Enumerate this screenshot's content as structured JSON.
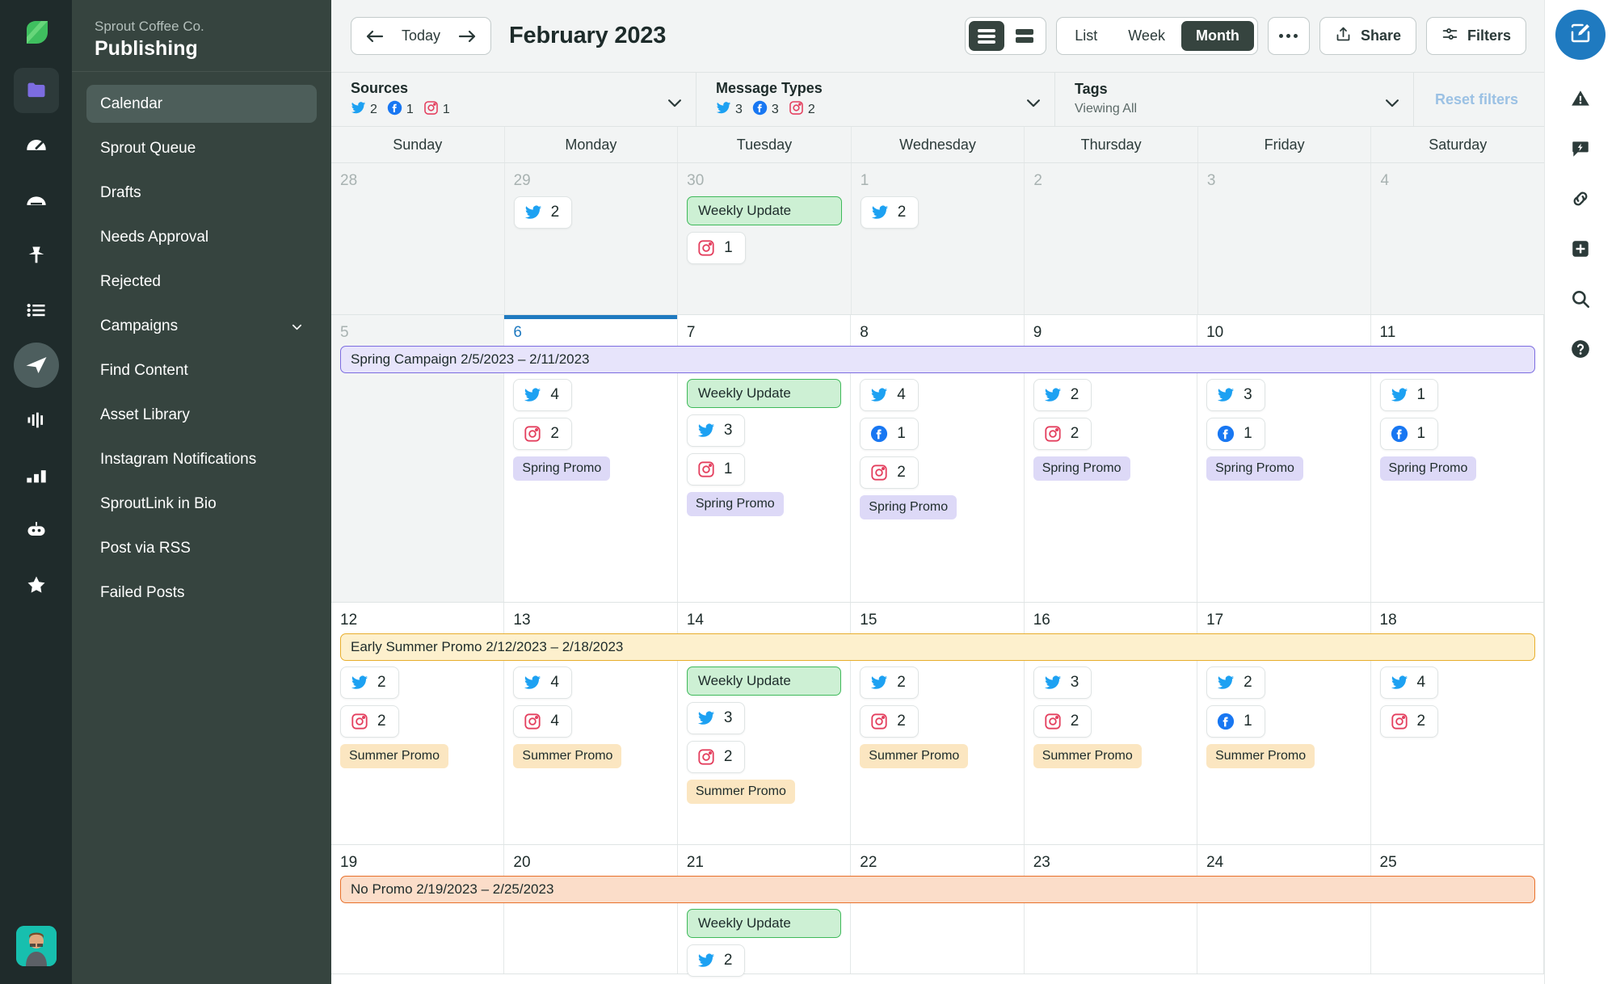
{
  "icon_rail": {
    "logo": "sprout-leaf-logo",
    "items": [
      {
        "icon": "folder-icon",
        "active": true
      },
      {
        "icon": "dashboard-gauge-icon",
        "active": false
      },
      {
        "icon": "inbox-icon",
        "active": false
      },
      {
        "icon": "pin-icon",
        "active": false
      },
      {
        "icon": "list-icon",
        "active": false
      },
      {
        "icon": "paper-plane-icon",
        "active": true
      },
      {
        "icon": "audio-waveform-icon",
        "active": false
      },
      {
        "icon": "bar-chart-icon",
        "active": false
      },
      {
        "icon": "bot-icon",
        "active": false
      },
      {
        "icon": "star-icon",
        "active": false
      }
    ],
    "avatar": "user-avatar"
  },
  "sidebar": {
    "org": "Sprout Coffee Co.",
    "title": "Publishing",
    "items": [
      {
        "label": "Calendar",
        "active": true,
        "chevron": false
      },
      {
        "label": "Sprout Queue",
        "active": false,
        "chevron": false
      },
      {
        "label": "Drafts",
        "active": false,
        "chevron": false
      },
      {
        "label": "Needs Approval",
        "active": false,
        "chevron": false
      },
      {
        "label": "Rejected",
        "active": false,
        "chevron": false
      },
      {
        "label": "Campaigns",
        "active": false,
        "chevron": true
      },
      {
        "label": "Find Content",
        "active": false,
        "chevron": false
      },
      {
        "label": "Asset Library",
        "active": false,
        "chevron": false
      },
      {
        "label": "Instagram Notifications",
        "active": false,
        "chevron": false
      },
      {
        "label": "SproutLink in Bio",
        "active": false,
        "chevron": false
      },
      {
        "label": "Post via RSS",
        "active": false,
        "chevron": false
      },
      {
        "label": "Failed Posts",
        "active": false,
        "chevron": false
      }
    ]
  },
  "toolbar": {
    "prev_icon": "arrow-left-icon",
    "today_label": "Today",
    "next_icon": "arrow-right-icon",
    "month_title": "February 2023",
    "density": [
      {
        "name": "rows-dense",
        "active": true
      },
      {
        "name": "rows-compact",
        "active": false
      }
    ],
    "views": [
      {
        "label": "List",
        "active": false
      },
      {
        "label": "Week",
        "active": false
      },
      {
        "label": "Month",
        "active": true
      }
    ],
    "more_label": "more-options",
    "share_label": "Share",
    "filters_label": "Filters"
  },
  "filters": {
    "sources": {
      "label": "Sources",
      "counts": [
        {
          "network": "twitter",
          "value": "2"
        },
        {
          "network": "facebook",
          "value": "1"
        },
        {
          "network": "instagram",
          "value": "1"
        }
      ]
    },
    "message_types": {
      "label": "Message Types",
      "counts": [
        {
          "network": "twitter",
          "value": "3"
        },
        {
          "network": "facebook",
          "value": "3"
        },
        {
          "network": "instagram",
          "value": "2"
        }
      ]
    },
    "tags": {
      "label": "Tags",
      "sub": "Viewing All"
    },
    "reset_label": "Reset filters"
  },
  "calendar": {
    "day_names": [
      "Sunday",
      "Monday",
      "Tuesday",
      "Wednesday",
      "Thursday",
      "Friday",
      "Saturday"
    ],
    "weeks": [
      {
        "banner": null,
        "days": [
          {
            "num": "28",
            "outside": true,
            "today": false,
            "events": []
          },
          {
            "num": "29",
            "outside": true,
            "today": false,
            "events": [
              {
                "type": "pill",
                "network": "twitter",
                "value": "2"
              }
            ]
          },
          {
            "num": "30",
            "outside": true,
            "today": false,
            "events": [
              {
                "type": "weekly",
                "label": "Weekly Update"
              },
              {
                "type": "pill",
                "network": "instagram",
                "value": "1"
              }
            ]
          },
          {
            "num": "1",
            "outside": true,
            "today": false,
            "events": [
              {
                "type": "pill",
                "network": "twitter",
                "value": "2"
              }
            ]
          },
          {
            "num": "2",
            "outside": true,
            "today": false,
            "events": []
          },
          {
            "num": "3",
            "outside": true,
            "today": false,
            "events": []
          },
          {
            "num": "4",
            "outside": true,
            "today": false,
            "events": []
          }
        ]
      },
      {
        "banner": {
          "label": "Spring Campaign 2/5/2023 – 2/11/2023",
          "color": "purple"
        },
        "days": [
          {
            "num": "5",
            "outside": true,
            "today": false,
            "events": []
          },
          {
            "num": "6",
            "outside": false,
            "today": true,
            "events": [
              {
                "type": "pill",
                "network": "twitter",
                "value": "4"
              },
              {
                "type": "pill",
                "network": "instagram",
                "value": "2"
              },
              {
                "type": "tag",
                "label": "Spring Promo",
                "color": "purple"
              }
            ]
          },
          {
            "num": "7",
            "outside": false,
            "today": false,
            "events": [
              {
                "type": "weekly",
                "label": "Weekly Update"
              },
              {
                "type": "pill",
                "network": "twitter",
                "value": "3"
              },
              {
                "type": "pill",
                "network": "instagram",
                "value": "1"
              },
              {
                "type": "tag",
                "label": "Spring Promo",
                "color": "purple"
              }
            ]
          },
          {
            "num": "8",
            "outside": false,
            "today": false,
            "events": [
              {
                "type": "pill",
                "network": "twitter",
                "value": "4"
              },
              {
                "type": "pill",
                "network": "facebook",
                "value": "1"
              },
              {
                "type": "pill",
                "network": "instagram",
                "value": "2"
              },
              {
                "type": "tag",
                "label": "Spring Promo",
                "color": "purple"
              }
            ]
          },
          {
            "num": "9",
            "outside": false,
            "today": false,
            "events": [
              {
                "type": "pill",
                "network": "twitter",
                "value": "2"
              },
              {
                "type": "pill",
                "network": "instagram",
                "value": "2"
              },
              {
                "type": "tag",
                "label": "Spring Promo",
                "color": "purple"
              }
            ]
          },
          {
            "num": "10",
            "outside": false,
            "today": false,
            "events": [
              {
                "type": "pill",
                "network": "twitter",
                "value": "3"
              },
              {
                "type": "pill",
                "network": "facebook",
                "value": "1"
              },
              {
                "type": "tag",
                "label": "Spring Promo",
                "color": "purple"
              }
            ]
          },
          {
            "num": "11",
            "outside": false,
            "today": false,
            "events": [
              {
                "type": "pill",
                "network": "twitter",
                "value": "1"
              },
              {
                "type": "pill",
                "network": "facebook",
                "value": "1"
              },
              {
                "type": "tag",
                "label": "Spring Promo",
                "color": "purple"
              }
            ]
          }
        ]
      },
      {
        "banner": {
          "label": "Early Summer Promo 2/12/2023 – 2/18/2023",
          "color": "amber"
        },
        "days": [
          {
            "num": "12",
            "outside": false,
            "today": false,
            "events": [
              {
                "type": "pill",
                "network": "twitter",
                "value": "2"
              },
              {
                "type": "pill",
                "network": "instagram",
                "value": "2"
              },
              {
                "type": "tag",
                "label": "Summer Promo",
                "color": "amber"
              }
            ]
          },
          {
            "num": "13",
            "outside": false,
            "today": false,
            "events": [
              {
                "type": "pill",
                "network": "twitter",
                "value": "4"
              },
              {
                "type": "pill",
                "network": "instagram",
                "value": "4"
              },
              {
                "type": "tag",
                "label": "Summer Promo",
                "color": "amber"
              }
            ]
          },
          {
            "num": "14",
            "outside": false,
            "today": false,
            "events": [
              {
                "type": "weekly",
                "label": "Weekly Update"
              },
              {
                "type": "pill",
                "network": "twitter",
                "value": "3"
              },
              {
                "type": "pill",
                "network": "instagram",
                "value": "2"
              },
              {
                "type": "tag",
                "label": "Summer Promo",
                "color": "amber"
              }
            ]
          },
          {
            "num": "15",
            "outside": false,
            "today": false,
            "events": [
              {
                "type": "pill",
                "network": "twitter",
                "value": "2"
              },
              {
                "type": "pill",
                "network": "instagram",
                "value": "2"
              },
              {
                "type": "tag",
                "label": "Summer Promo",
                "color": "amber"
              }
            ]
          },
          {
            "num": "16",
            "outside": false,
            "today": false,
            "events": [
              {
                "type": "pill",
                "network": "twitter",
                "value": "3"
              },
              {
                "type": "pill",
                "network": "instagram",
                "value": "2"
              },
              {
                "type": "tag",
                "label": "Summer Promo",
                "color": "amber"
              }
            ]
          },
          {
            "num": "17",
            "outside": false,
            "today": false,
            "events": [
              {
                "type": "pill",
                "network": "twitter",
                "value": "2"
              },
              {
                "type": "pill",
                "network": "facebook",
                "value": "1"
              },
              {
                "type": "tag",
                "label": "Summer Promo",
                "color": "amber"
              }
            ]
          },
          {
            "num": "18",
            "outside": false,
            "today": false,
            "events": [
              {
                "type": "pill",
                "network": "twitter",
                "value": "4"
              },
              {
                "type": "pill",
                "network": "instagram",
                "value": "2"
              }
            ]
          }
        ]
      },
      {
        "banner": {
          "label": "No Promo 2/19/2023 – 2/25/2023",
          "color": "coral"
        },
        "days": [
          {
            "num": "19",
            "outside": false,
            "today": false,
            "events": []
          },
          {
            "num": "20",
            "outside": false,
            "today": false,
            "events": []
          },
          {
            "num": "21",
            "outside": false,
            "today": false,
            "events": [
              {
                "type": "weekly",
                "label": "Weekly Update"
              },
              {
                "type": "pill",
                "network": "twitter",
                "value": "2"
              }
            ]
          },
          {
            "num": "22",
            "outside": false,
            "today": false,
            "events": []
          },
          {
            "num": "23",
            "outside": false,
            "today": false,
            "events": []
          },
          {
            "num": "24",
            "outside": false,
            "today": false,
            "events": []
          },
          {
            "num": "25",
            "outside": false,
            "today": false,
            "events": []
          }
        ]
      }
    ]
  },
  "right_rail": {
    "compose": "compose-icon",
    "items": [
      {
        "icon": "alert-triangle-icon"
      },
      {
        "icon": "lightning-chat-icon"
      },
      {
        "icon": "link-icon"
      },
      {
        "icon": "plus-square-icon"
      },
      {
        "icon": "search-icon"
      },
      {
        "icon": "help-circle-icon"
      }
    ]
  },
  "colors": {
    "brand_green": "#5bc45b",
    "accent_blue": "#1f7ac0",
    "sidebar_bg": "#36443f",
    "rail_bg": "#1f2b2b",
    "twitter": "#1da1f2",
    "facebook": "#1877f2",
    "instagram": "#e4405f"
  }
}
